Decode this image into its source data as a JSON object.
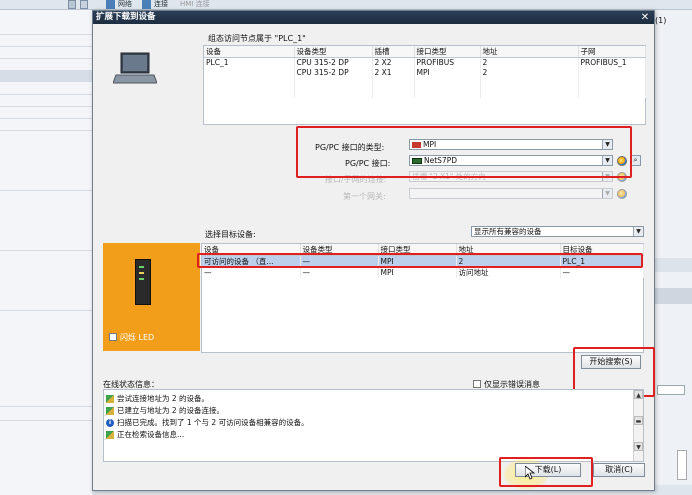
{
  "app": {
    "toolbar": {
      "network_label": "网络",
      "connect_label": "连接",
      "hmi_label": "HMI 连接"
    },
    "right_panel_tab": "(1)"
  },
  "dialog": {
    "title": "扩展下载到设备",
    "close_label": "✕",
    "config_header": "组态访问节点属于 \"PLC_1\"",
    "config_table": {
      "columns": [
        "设备",
        "设备类型",
        "插槽",
        "接口类型",
        "地址",
        "子网"
      ],
      "rows": [
        [
          "PLC_1",
          "CPU 315-2 DP",
          "2 X2",
          "PROFIBUS",
          "2",
          "PROFIBUS_1"
        ],
        [
          "",
          "CPU 315-2 DP",
          "2 X1",
          "MPI",
          "2",
          ""
        ]
      ]
    },
    "pgpc_type_label": "PG/PC 接口的类型:",
    "pgpc_type_value": "MPI",
    "pgpc_iface_label": "PG/PC 接口:",
    "pgpc_iface_value": "NetS7PD",
    "subnet_conn_label": "接口/子网的连接:",
    "subnet_conn_value": "插槽 \"2 X1\" 处的方向",
    "first_gateway_label": "第一个网关:",
    "first_gateway_value": "",
    "select_target_label": "选择目标设备:",
    "target_filter_value": "显示所有兼容的设备",
    "target_table": {
      "columns": [
        "设备",
        "设备类型",
        "接口类型",
        "地址",
        "目标设备"
      ],
      "rows": [
        [
          "可访问的设备 （直...",
          "—",
          "MPI",
          "2",
          "PLC_1"
        ],
        [
          "—",
          "—",
          "MPI",
          "访问地址",
          "—"
        ]
      ]
    },
    "flash_led_label": "闪烁 LED",
    "start_search_label": "开始搜索(S)",
    "online_status_label": "在线状态信息：",
    "only_errors_label": "仅显示错误消息",
    "status_messages": [
      "尝试连接地址为 2 的设备。",
      "已建立与地址为 2 的设备连接。",
      "扫描已完成。找到了 1 个与 2 可访问设备相兼容的设备。",
      "正在检索设备信息..."
    ],
    "download_label": "下载(L)",
    "cancel_label": "取消(C)"
  },
  "colors": {
    "titlebar": "#1d2d40",
    "highlight_red": "#e02020",
    "device_panel_orange": "#f29e1a",
    "selected_row": "#bcd0ec"
  }
}
